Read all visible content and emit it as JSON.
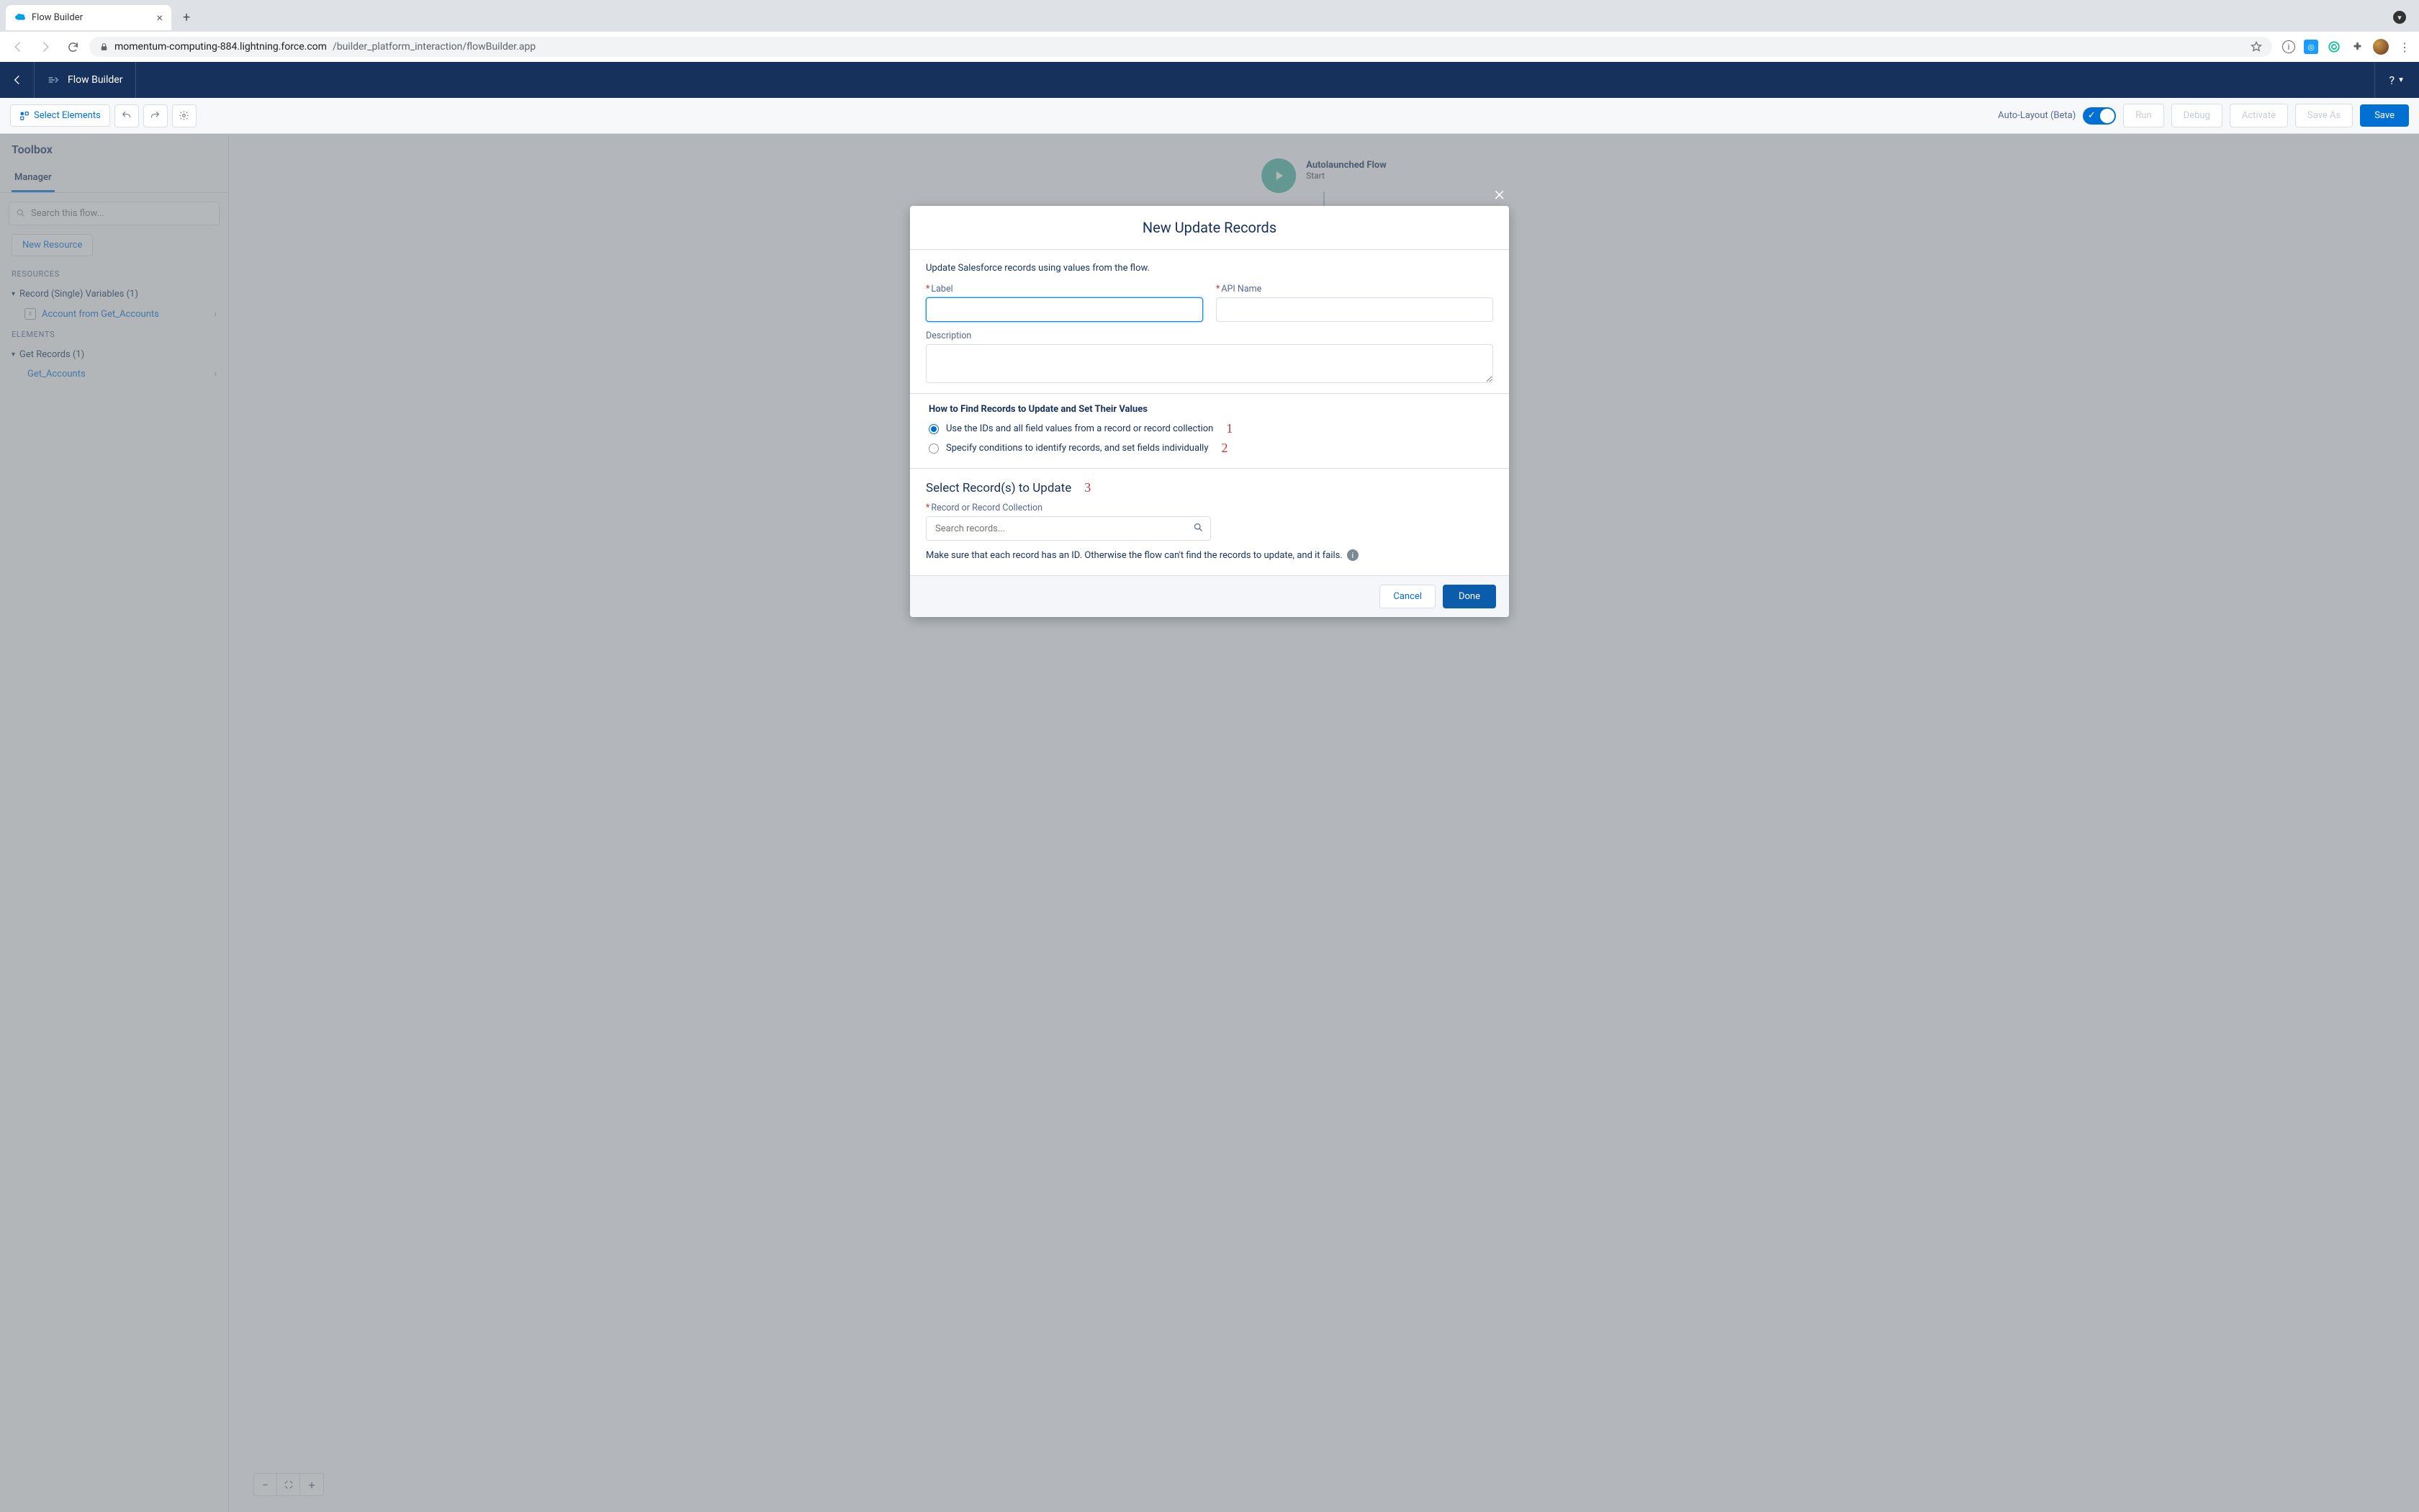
{
  "browser": {
    "tab_title": "Flow Builder",
    "url_host": "momentum-computing-884.lightning.force.com",
    "url_path": "/builder_platform_interaction/flowBuilder.app"
  },
  "header": {
    "app_title": "Flow Builder",
    "help_label": "?"
  },
  "toolbar": {
    "select_elements": "Select Elements",
    "auto_layout": "Auto-Layout (Beta)",
    "run": "Run",
    "debug": "Debug",
    "activate": "Activate",
    "save_as": "Save As",
    "save": "Save"
  },
  "sidebar": {
    "title": "Toolbox",
    "tab": "Manager",
    "search_placeholder": "Search this flow...",
    "new_resource": "New Resource",
    "section_resources": "RESOURCES",
    "cat_record_vars": "Record (Single) Variables (1)",
    "item_account": "Account from Get_Accounts",
    "section_elements": "ELEMENTS",
    "cat_get_records": "Get Records (1)",
    "item_get_accounts": "Get_Accounts"
  },
  "canvas": {
    "start_title": "Autolaunched Flow",
    "start_sub": "Start"
  },
  "modal": {
    "title": "New Update Records",
    "description": "Update Salesforce records using values from the flow.",
    "label_label": "Label",
    "label_api": "API Name",
    "label_desc": "Description",
    "how_title": "How to Find Records to Update and Set Their Values",
    "radio1": "Use the IDs and all field values from a record or record collection",
    "radio2": "Specify conditions to identify records, and set fields individually",
    "annot1": "1",
    "annot2": "2",
    "annot3": "3",
    "select_title": "Select Record(s) to Update",
    "record_label": "Record or Record Collection",
    "record_placeholder": "Search records...",
    "hint": "Make sure that each record has an ID. Otherwise the flow can't find the records to update, and it fails.",
    "cancel": "Cancel",
    "done": "Done"
  }
}
